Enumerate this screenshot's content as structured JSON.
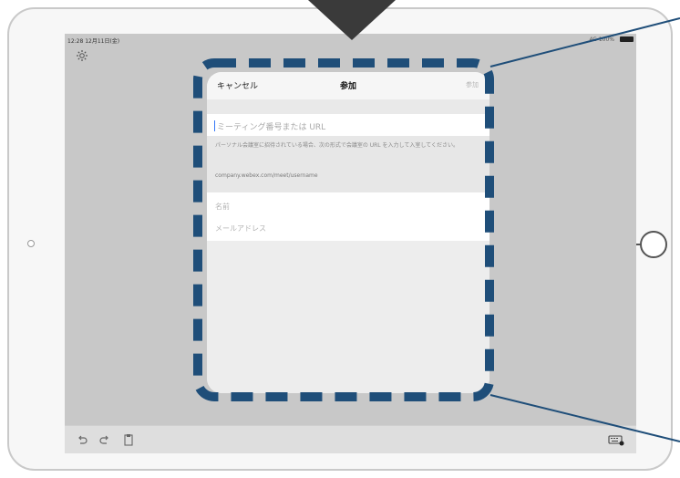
{
  "status_bar": {
    "time": "12:28  12月11日(金)",
    "right": "4G 100%"
  },
  "dialog": {
    "cancel": "キャンセル",
    "title": "参加",
    "join": "参加",
    "meeting_placeholder": "ミーティング番号または URL",
    "help_text": "パーソナル会議室に招待されている場合、次の形式で会議室の URL を入力して入室してください。",
    "help_example": "company.webex.com/meet/username",
    "name_placeholder": "名前",
    "email_placeholder": "メールアドレス"
  },
  "icons": {
    "settings": "gear-icon",
    "undo": "undo-icon",
    "redo": "redo-icon",
    "clipboard": "clipboard-icon",
    "keyboard": "keyboard-icon"
  },
  "colors": {
    "annotation": "#1f4e79",
    "arrow": "#3a3a3a",
    "caret": "#3478f6"
  }
}
